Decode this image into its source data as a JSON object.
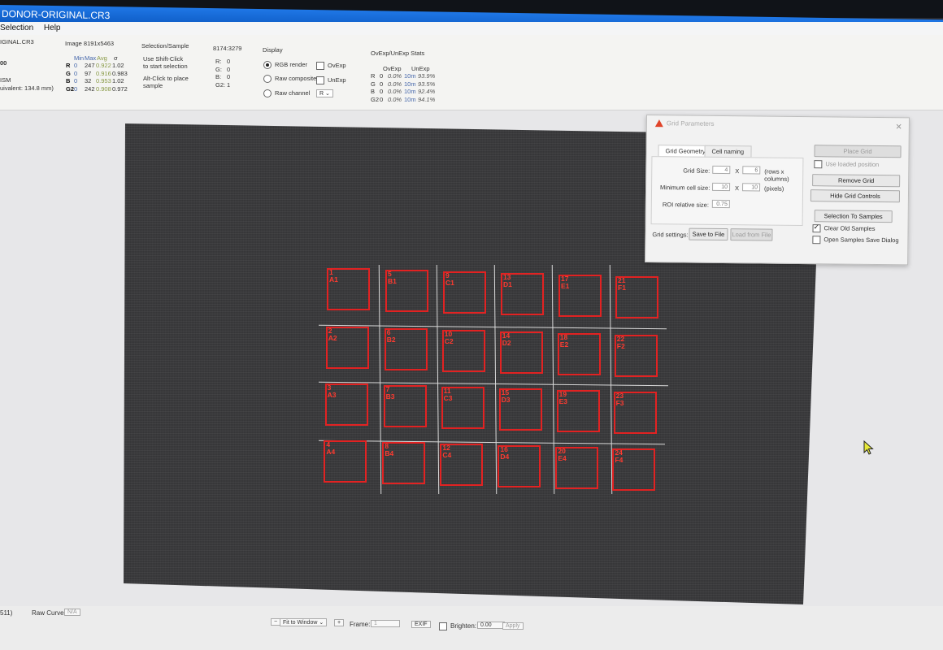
{
  "window": {
    "title": "DONOR-ORIGINAL.CR3"
  },
  "menu": [
    "Selection",
    "Help"
  ],
  "info": {
    "file_name": "IGINAL.CR3",
    "zoom_frag": "00",
    "lens_frag": "ISM",
    "equiv_frag": "uivalent: 134.8 mm)",
    "image_size": "Image 8191x5463",
    "stats_headers": [
      "Min",
      "Max",
      "Avg",
      "σ"
    ],
    "stats_rows": [
      {
        "ch": "R",
        "min": "0",
        "max": "247",
        "avg": "0.922",
        "sd": "1.02"
      },
      {
        "ch": "G",
        "min": "0",
        "max": "97",
        "avg": "0.916",
        "sd": "0.983"
      },
      {
        "ch": "B",
        "min": "0",
        "max": "32",
        "avg": "0.953",
        "sd": "1.02"
      },
      {
        "ch": "G2",
        "min": "0",
        "max": "242",
        "avg": "0.908",
        "sd": "0.972"
      }
    ],
    "selection_title": "Selection/Sample",
    "selection_help1": "Use Shift-Click",
    "selection_help2": "to start selection",
    "selection_help3": "Alt-Click to place",
    "selection_help4": "sample",
    "coords": "8174:3279",
    "pixel_values": [
      {
        "ch": "R:",
        "v": "0"
      },
      {
        "ch": "G:",
        "v": "0"
      },
      {
        "ch": "B:",
        "v": "0"
      },
      {
        "ch": "G2:",
        "v": "1"
      }
    ],
    "display_title": "Display",
    "display_options": [
      "RGB render",
      "Raw composite",
      "Raw channel"
    ],
    "ovexp_label": "OvExp",
    "unexp_label": "UnExp",
    "raw_channel_value": "R",
    "ovexp_title": "OvExp/UnExp Stats",
    "ovexp_headers": [
      "OvExp",
      "UnExp"
    ],
    "ovexp_rows": [
      {
        "ch": "R",
        "o": "0",
        "op": "0.0%",
        "u": "10m",
        "up": "93.9%"
      },
      {
        "ch": "G",
        "o": "0",
        "op": "0.0%",
        "u": "10m",
        "up": "93.5%"
      },
      {
        "ch": "B",
        "o": "0",
        "op": "0.0%",
        "u": "10m",
        "up": "92.4%"
      },
      {
        "ch": "G2",
        "o": "0",
        "op": "0.0%",
        "u": "10m",
        "up": "94.1%"
      }
    ]
  },
  "grid_cells": [
    [
      "1\nA1",
      "5\nB1",
      "9\nC1",
      "13\nD1",
      "17\nE1",
      "21\nF1"
    ],
    [
      "2\nA2",
      "6\nB2",
      "10\nC2",
      "14\nD2",
      "18\nE2",
      "22\nF2"
    ],
    [
      "3\nA3",
      "7\nB3",
      "11\nC3",
      "15\nD3",
      "19\nE3",
      "23\nF3"
    ],
    [
      "4\nA4",
      "8\nB4",
      "12\nC4",
      "16\nD4",
      "20\nE4",
      "24\nF4"
    ]
  ],
  "dialog": {
    "title": "Grid Parameters",
    "tabs": [
      "Grid Geometry",
      "Cell naming"
    ],
    "grid_size_label": "Grid Size:",
    "rows": "4",
    "cols": "6",
    "x": "X",
    "rows_cols_note": "(rows x columns)",
    "min_cell_label": "Minimum cell size:",
    "min_w": "10",
    "min_h": "10",
    "pixels_note": "(pixels)",
    "roi_label": "ROI relative size:",
    "roi": "0.75",
    "grid_settings_label": "Grid settings:",
    "save_btn": "Save to File",
    "load_btn": "Load from File",
    "place_btn": "Place Grid",
    "use_loaded": "Use loaded position",
    "remove_btn": "Remove Grid",
    "hide_btn": "Hide Grid Controls",
    "sel_samples_btn": "Selection To Samples",
    "clear_old": "Clear Old Samples",
    "open_dialog": "Open Samples Save Dialog"
  },
  "status": {
    "left_frag": "511)",
    "raw_curve_label": "Raw Curve:",
    "raw_curve_value": "N/A",
    "fit_label": "Fit to Window",
    "frame_label": "Frame:",
    "frame_value": "1",
    "exif_btn": "EXIF",
    "brighten_label": "Brighten:",
    "brighten_value": "0.00",
    "apply_btn": "Apply"
  }
}
